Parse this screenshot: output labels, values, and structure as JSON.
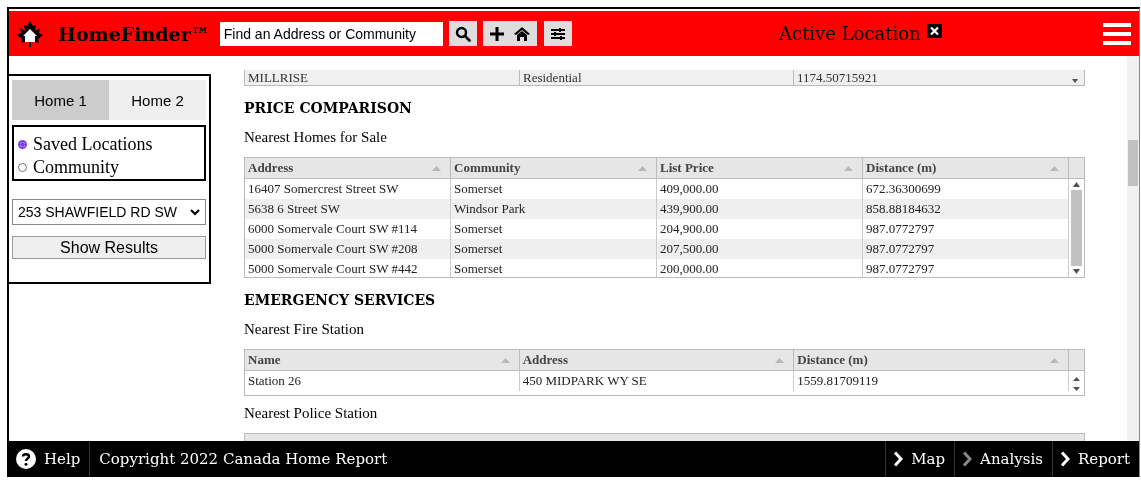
{
  "header": {
    "title": "HomeFinder™",
    "search": {
      "placeholder": "Find an Address or Community"
    },
    "active_location": "Active Location"
  },
  "sidebar": {
    "tabs": [
      {
        "label": "Home 1",
        "selected": true
      },
      {
        "label": "Home 2",
        "selected": false
      }
    ],
    "radios": [
      {
        "label": "Saved Locations",
        "selected": true
      },
      {
        "label": "Community",
        "selected": false
      }
    ],
    "address_select": "253 SHAWFIELD RD SW",
    "button": "Show Results"
  },
  "content": {
    "previous_row": [
      "MILLRISE",
      "Residential",
      "1174.50715921"
    ],
    "sections": [
      {
        "title": "PRICE COMPARISON",
        "tables": [
          {
            "caption": "Nearest Homes for Sale",
            "columns": [
              "Address",
              "Community",
              "List Price",
              "Distance (m)"
            ],
            "rows": [
              [
                "16407 Somercrest Street SW",
                "Somerset",
                "409,000.00",
                "672.36300699"
              ],
              [
                "5638 6 Street SW",
                "Windsor Park",
                "439,900.00",
                "858.88184632"
              ],
              [
                "6000 Somervale Court SW #114",
                "Somerset",
                "204,900.00",
                "987.0772797"
              ],
              [
                "5000 Somervale Court SW #208",
                "Somerset",
                "207,500.00",
                "987.0772797"
              ],
              [
                "5000 Somervale Court SW #442",
                "Somerset",
                "200,000.00",
                "987.0772797"
              ]
            ]
          }
        ]
      },
      {
        "title": "EMERGENCY SERVICES",
        "tables": [
          {
            "caption": "Nearest Fire Station",
            "columns": [
              "Name",
              "Address",
              "Distance (m)"
            ],
            "rows": [
              [
                "Station 26",
                "450 MIDPARK WY SE",
                "1559.81709119"
              ]
            ]
          },
          {
            "caption": "Nearest Police Station"
          }
        ]
      }
    ]
  },
  "footer": {
    "help": "Help",
    "copyright": "Copyright 2022 Canada Home Report",
    "nav": [
      {
        "label": "Map",
        "disabled": false
      },
      {
        "label": "Analysis",
        "disabled": true
      },
      {
        "label": "Report",
        "disabled": false
      }
    ]
  }
}
